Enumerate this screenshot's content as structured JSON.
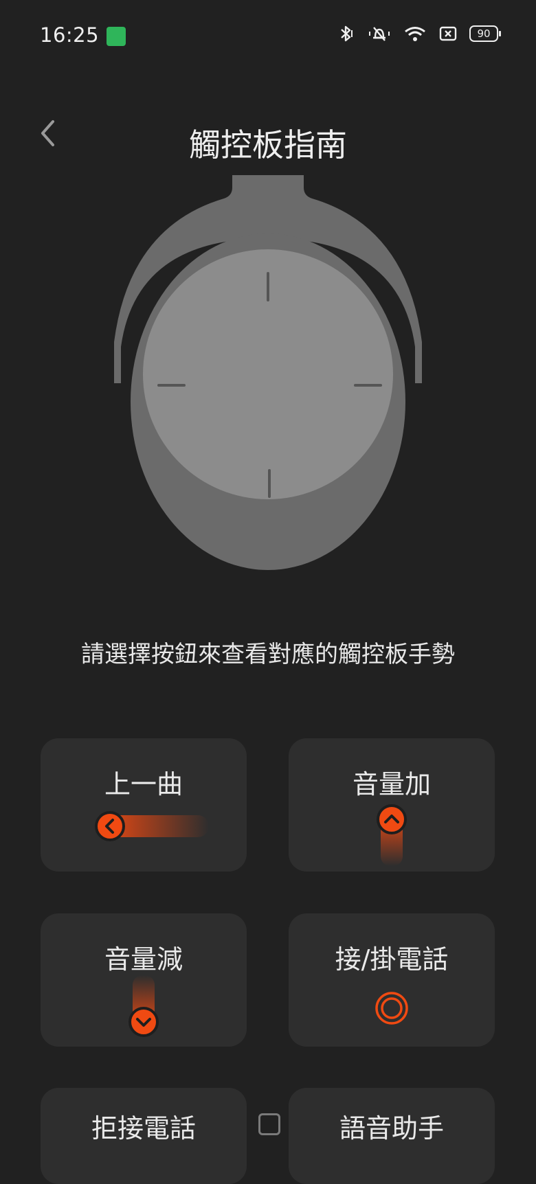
{
  "status_bar": {
    "time": "16:25",
    "battery_level": "90"
  },
  "header": {
    "title": "觸控板指南"
  },
  "instruction": "請選擇按鈕來查看對應的觸控板手勢",
  "gesture_buttons": [
    {
      "label": "上一曲",
      "icon": "swipe-left-icon"
    },
    {
      "label": "音量加",
      "icon": "swipe-up-icon"
    },
    {
      "label": "音量減",
      "icon": "swipe-down-icon"
    },
    {
      "label": "接/掛電話",
      "icon": "double-tap-icon"
    },
    {
      "label": "拒接電話",
      "icon": ""
    },
    {
      "label": "語音助手",
      "icon": ""
    }
  ],
  "colors": {
    "background": "#212121",
    "card": "#2e2e2e",
    "accent": "#f04a12",
    "headphone_outer": "#6b6b6b",
    "headphone_inner": "#8c8c8c"
  }
}
